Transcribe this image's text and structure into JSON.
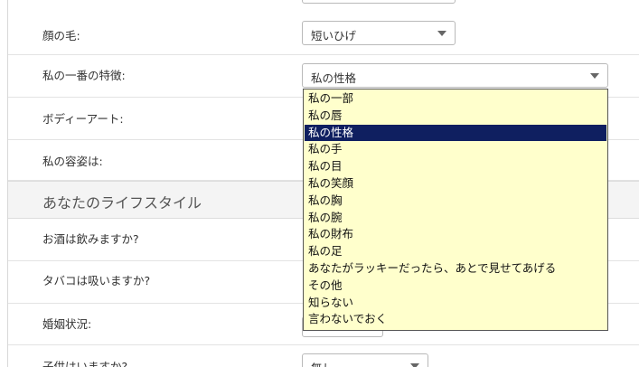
{
  "fields": {
    "facial_hair": {
      "label": "顔の毛:",
      "value": "短いひげ"
    },
    "best_feature": {
      "label": "私の一番の特徴:",
      "value": "私の性格"
    },
    "body_art": {
      "label": "ボディーアート:"
    },
    "appearance": {
      "label": "私の容姿は:"
    }
  },
  "section": {
    "title": "あなたのライフスタイル"
  },
  "lifestyle": {
    "drink": {
      "label": "お酒は飲みますか?"
    },
    "smoke": {
      "label": "タバコは吸いますか?"
    },
    "marital": {
      "label": "婚姻状況:"
    },
    "children": {
      "label": "子供はいますか?",
      "value": "無し"
    }
  },
  "dropdown": {
    "selected_index": 2,
    "options": [
      "私の一部",
      "私の唇",
      "私の性格",
      "私の手",
      "私の目",
      "私の笑顔",
      "私の胸",
      "私の腕",
      "私の財布",
      "私の足",
      "あなたがラッキーだったら、あとで見せてあげる",
      "その他",
      "知らない",
      "言わないでおく"
    ]
  }
}
